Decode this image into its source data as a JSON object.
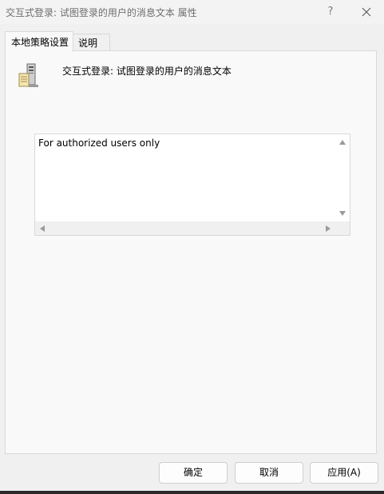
{
  "window": {
    "title": "交互式登录: 试图登录的用户的消息文本 属性",
    "help_label": "?",
    "close_icon": "close-icon"
  },
  "tabs": [
    {
      "label": "本地策略设置",
      "active": true
    },
    {
      "label": "说明",
      "active": false
    }
  ],
  "policy": {
    "icon": "server-icon",
    "name": "交互式登录: 试图登录的用户的消息文本"
  },
  "message_text": {
    "value": "For authorized users only"
  },
  "buttons": {
    "ok": "确定",
    "cancel": "取消",
    "apply": "应用(A)"
  }
}
